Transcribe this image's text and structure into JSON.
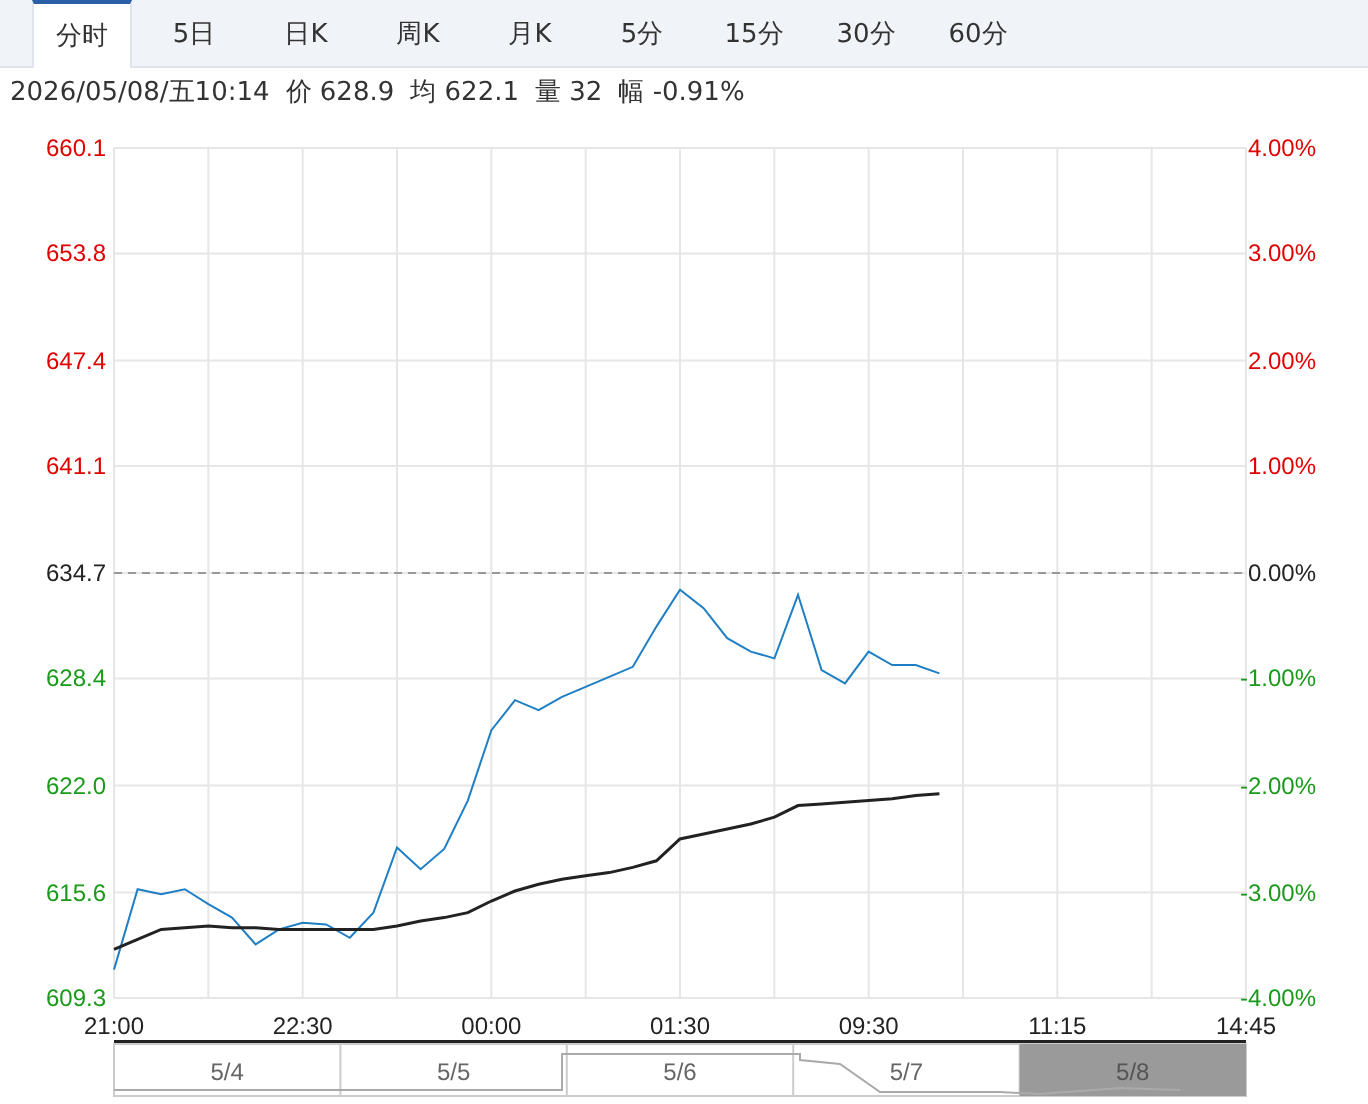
{
  "tabs": [
    {
      "label": "分时",
      "selected": true
    },
    {
      "label": "5日",
      "selected": false
    },
    {
      "label": "日K",
      "selected": false
    },
    {
      "label": "周K",
      "selected": false
    },
    {
      "label": "月K",
      "selected": false
    },
    {
      "label": "5分",
      "selected": false
    },
    {
      "label": "15分",
      "selected": false
    },
    {
      "label": "30分",
      "selected": false
    },
    {
      "label": "60分",
      "selected": false
    }
  ],
  "info": {
    "datetime": "2026/05/08/五10:14",
    "fields": [
      {
        "label": "价",
        "value": "628.9"
      },
      {
        "label": "均",
        "value": "622.1"
      },
      {
        "label": "量",
        "value": "32"
      },
      {
        "label": "幅",
        "value": "-0.91%"
      }
    ]
  },
  "chart": {
    "chart_data": {
      "type": "line",
      "categories": [
        "21:00",
        null,
        null,
        null,
        null,
        null,
        null,
        null,
        "22:30",
        null,
        null,
        null,
        null,
        null,
        null,
        null,
        "00:00",
        null,
        null,
        null,
        null,
        null,
        null,
        null,
        "01:30",
        null,
        null,
        null,
        null,
        null,
        null,
        null,
        "09:30",
        null,
        null,
        null,
        null,
        null,
        null,
        null,
        "11:15",
        null,
        null,
        null,
        null,
        null,
        null,
        null,
        "14:45"
      ],
      "series": [
        {
          "color": "#1f7fc4",
          "values": [
            611.0,
            615.8,
            615.5,
            615.8,
            614.9,
            614.1,
            612.5,
            613.4,
            613.8,
            613.7,
            612.9,
            614.4,
            618.3,
            617.0,
            618.2,
            621.1,
            625.3,
            627.1,
            626.5,
            627.3,
            627.9,
            628.5,
            629.1,
            631.5,
            633.7,
            632.6,
            630.8,
            630.0,
            629.6,
            633.4,
            628.9,
            628.1,
            630.0,
            629.2,
            629.2,
            628.7,
            null,
            null,
            null,
            null,
            null,
            null,
            null,
            null,
            null,
            null,
            null,
            null,
            null
          ]
        },
        {
          "color": "#222222",
          "values": [
            612.2,
            612.8,
            613.4,
            613.5,
            613.6,
            613.5,
            613.5,
            613.4,
            613.4,
            613.4,
            613.4,
            613.4,
            613.6,
            613.9,
            614.1,
            614.4,
            615.1,
            615.7,
            616.1,
            616.4,
            616.6,
            616.8,
            617.1,
            617.5,
            618.8,
            619.1,
            619.4,
            619.7,
            620.1,
            620.8,
            620.9,
            621.0,
            621.1,
            621.2,
            621.4,
            621.5,
            null,
            null,
            null,
            null,
            null,
            null,
            null,
            null,
            null,
            null,
            null,
            null,
            null
          ]
        }
      ],
      "ylim": [
        609.3,
        660.1
      ],
      "grid": true,
      "ref_lines": [
        {
          "axis": "y",
          "value": 634.7
        }
      ],
      "yticks": [
        {
          "value": 660.1,
          "label": "660.1"
        },
        {
          "value": 653.8,
          "label": "653.8"
        },
        {
          "value": 647.4,
          "label": "647.4"
        },
        {
          "value": 641.1,
          "label": "641.1"
        },
        {
          "value": 634.7,
          "label": "634.7"
        },
        {
          "value": 628.4,
          "label": "628.4"
        },
        {
          "value": 622.0,
          "label": "622.0"
        },
        {
          "value": 615.6,
          "label": "615.6"
        },
        {
          "value": 609.3,
          "label": "609.3"
        }
      ]
    },
    "y_levels": [
      {
        "color": "#e00000",
        "right_label": "4.00%"
      },
      {
        "color": "#e00000",
        "right_label": "3.00%"
      },
      {
        "color": "#e00000",
        "right_label": "2.00%"
      },
      {
        "color": "#e00000",
        "right_label": "1.00%"
      },
      {
        "color": "#222222",
        "right_label": "0.00%"
      },
      {
        "color": "#1a9a1a",
        "right_label": "-1.00%"
      },
      {
        "color": "#1a9a1a",
        "right_label": "-2.00%"
      },
      {
        "color": "#1a9a1a",
        "right_label": "-3.00%"
      },
      {
        "color": "#1a9a1a",
        "right_label": "-4.00%"
      }
    ]
  },
  "navigator": {
    "days": [
      {
        "label": "5/4",
        "selected": false
      },
      {
        "label": "5/5",
        "selected": false
      },
      {
        "label": "5/6",
        "selected": false
      },
      {
        "label": "5/7",
        "selected": false
      },
      {
        "label": "5/8",
        "selected": true
      }
    ]
  }
}
